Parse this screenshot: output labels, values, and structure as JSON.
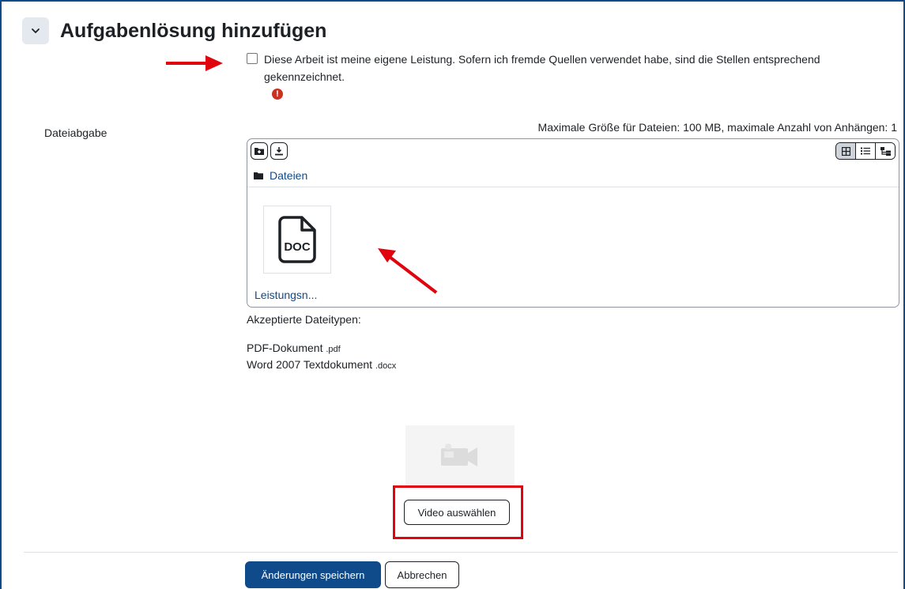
{
  "section": {
    "title": "Aufgabenlösung hinzufügen"
  },
  "statement": {
    "label": "Diese Arbeit ist meine eigene Leistung. Sofern ich fremde Quellen verwendet habe, sind die Stellen entsprechend gekennzeichnet.",
    "checked": false,
    "error_glyph": "!"
  },
  "file_submission": {
    "label": "Dateiabgabe",
    "max_info": "Maximale Größe für Dateien: 100 MB, maximale Anzahl von Anhängen: 1",
    "path_label": "Dateien",
    "file_name": "Leistungsn...",
    "file_type_label": "DOC",
    "accepted_title": "Akzeptierte Dateitypen:",
    "accepted_types": [
      {
        "name": "PDF-Dokument",
        "ext": ".pdf"
      },
      {
        "name": "Word 2007 Textdokument",
        "ext": ".docx"
      }
    ]
  },
  "video": {
    "button_label": "Video auswählen"
  },
  "actions": {
    "save_label": "Änderungen speichern",
    "cancel_label": "Abbrechen"
  },
  "colors": {
    "primary": "#0f4a8a",
    "annotation_red": "#e0040e",
    "error_red": "#ca3120"
  }
}
